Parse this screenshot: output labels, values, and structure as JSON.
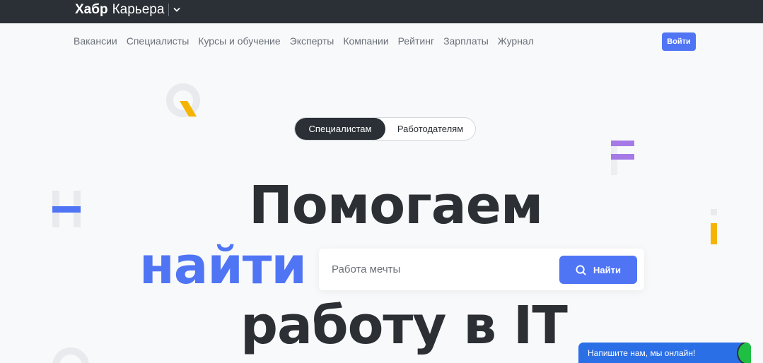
{
  "header": {
    "brand_bold": "Хабр",
    "brand_rest": "Карьера",
    "chevron_icon": "chevron-down-icon"
  },
  "nav": {
    "items": [
      {
        "label": "Вакансии"
      },
      {
        "label": "Специалисты"
      },
      {
        "label": "Курсы и обучение"
      },
      {
        "label": "Эксперты"
      },
      {
        "label": "Компании"
      },
      {
        "label": "Рейтинг"
      },
      {
        "label": "Зарплаты"
      },
      {
        "label": "Журнал"
      }
    ],
    "login_label": "Войти"
  },
  "audience_switch": {
    "active_label": "Специалистам",
    "inactive_label": "Работодателям"
  },
  "hero": {
    "line1": "Помогаем",
    "line2": "найти",
    "line3": "работу в IT"
  },
  "search": {
    "placeholder": "Работа мечты",
    "value": "",
    "button_label": "Найти",
    "icon": "search-icon"
  },
  "chat": {
    "label": "Напишите нам, мы онлайн!"
  },
  "colors": {
    "accent": "#4f75f5",
    "header_bg": "#2b3036",
    "text_dark": "#2c2f33",
    "text_muted": "#6a7078",
    "deco_yellow": "#f5b400",
    "deco_purple": "#a57ae6",
    "deco_grey": "#e8eaed",
    "chat_blue": "#2b6fe6",
    "chat_green": "#1fbf44"
  }
}
